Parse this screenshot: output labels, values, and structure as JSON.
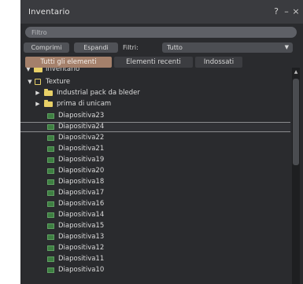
{
  "window": {
    "title": "Inventario",
    "help_glyph": "?",
    "minimize_glyph": "–",
    "close_glyph": "×"
  },
  "filter": {
    "placeholder": "Filtro",
    "value": ""
  },
  "toolbar": {
    "collapse_label": "Comprimi",
    "expand_label": "Espandi",
    "filters_label": "Filtri:",
    "filter_select_value": "Tutto"
  },
  "tabs": [
    {
      "label": "Tutti gli elementi",
      "active": true
    },
    {
      "label": "Elementi recenti",
      "active": false
    },
    {
      "label": "Indossati",
      "active": false
    }
  ],
  "tree": {
    "root_label": "Inventario",
    "textures_label": "Texture",
    "subfolders": [
      "Industrial pack da bleder",
      "prima di unicam"
    ],
    "items": [
      "Diapositiva23",
      "Diapositiva24",
      "Diapositiva22",
      "Diapositiva21",
      "Diapositiva19",
      "Diapositiva20",
      "Diapositiva18",
      "Diapositiva17",
      "Diapositiva16",
      "Diapositiva14",
      "Diapositiva15",
      "Diapositiva13",
      "Diapositiva12",
      "Diapositiva11",
      "Diapositiva10"
    ],
    "selected_item": "Diapositiva24"
  },
  "colors": {
    "panel_bg": "#2a2b2e",
    "active_tab": "#a4806b",
    "folder": "#e8d067",
    "texture": "#3e7f42"
  }
}
